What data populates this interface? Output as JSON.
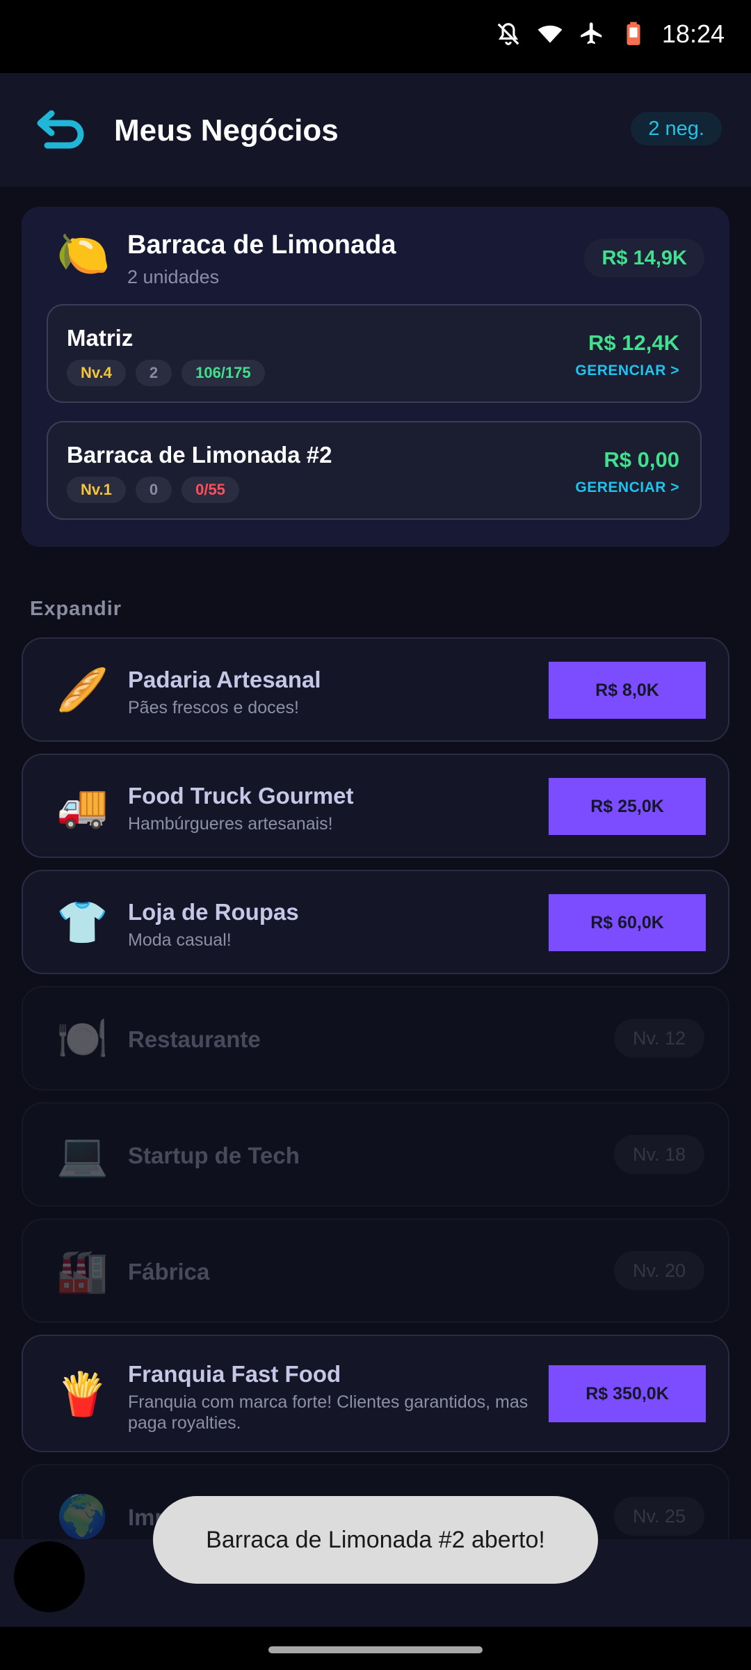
{
  "status_bar": {
    "time": "18:24",
    "icons": [
      "notifications-off-icon",
      "wifi-icon",
      "airplane-icon",
      "battery-low-icon"
    ]
  },
  "header": {
    "title": "Meus Negócios",
    "count_badge": "2 neg.",
    "back_icon": "undo-arrow-icon",
    "accent_color": "#1fb6d8"
  },
  "owned_business": {
    "emoji": "🍋",
    "name": "Barraca de Limonada",
    "units_label": "2 unidades",
    "total_value": "R$ 14,9K",
    "units": [
      {
        "name": "Matriz",
        "level": "Nv.4",
        "employees": "2",
        "capacity": "106/175",
        "capacity_status": "ok",
        "value": "R$ 12,4K",
        "manage_label": "GERENCIAR >"
      },
      {
        "name": "Barraca de Limonada #2",
        "level": "Nv.1",
        "employees": "0",
        "capacity": "0/55",
        "capacity_status": "low",
        "value": "R$ 0,00",
        "manage_label": "GERENCIAR >"
      }
    ]
  },
  "expand": {
    "title": "Expandir",
    "items": [
      {
        "emoji": "🥖",
        "name": "Padaria Artesanal",
        "description": "Pães frescos e doces!",
        "price": "R$ 8,0K",
        "locked": false
      },
      {
        "emoji": "🚚",
        "name": "Food Truck Gourmet",
        "description": "Hambúrgueres artesanais!",
        "price": "R$ 25,0K",
        "locked": false
      },
      {
        "emoji": "👕",
        "name": "Loja de Roupas",
        "description": "Moda casual!",
        "price": "R$ 60,0K",
        "locked": false
      },
      {
        "emoji": "🍽️",
        "name": "Restaurante",
        "required_level": "Nv. 12",
        "locked": true
      },
      {
        "emoji": "💻",
        "name": "Startup de Tech",
        "required_level": "Nv. 18",
        "locked": true
      },
      {
        "emoji": "🏭",
        "name": "Fábrica",
        "required_level": "Nv. 20",
        "locked": true
      },
      {
        "emoji": "🍟",
        "name": "Franquia Fast Food",
        "description": "Franquia com marca forte! Clientes garantidos, mas paga royalties.",
        "price": "R$ 350,0K",
        "locked": false
      },
      {
        "emoji": "🌍",
        "name": "Importadora Global",
        "required_level": "Nv. 25",
        "locked": true
      }
    ]
  },
  "toast": {
    "message": "Barraca de Limonada #2 aberto!"
  },
  "colors": {
    "background": "#0d0e19",
    "money_green": "#41e08e",
    "buy_purple": "#7c4dff",
    "level_yellow": "#f2c53d",
    "danger_red": "#ff4f5b"
  }
}
